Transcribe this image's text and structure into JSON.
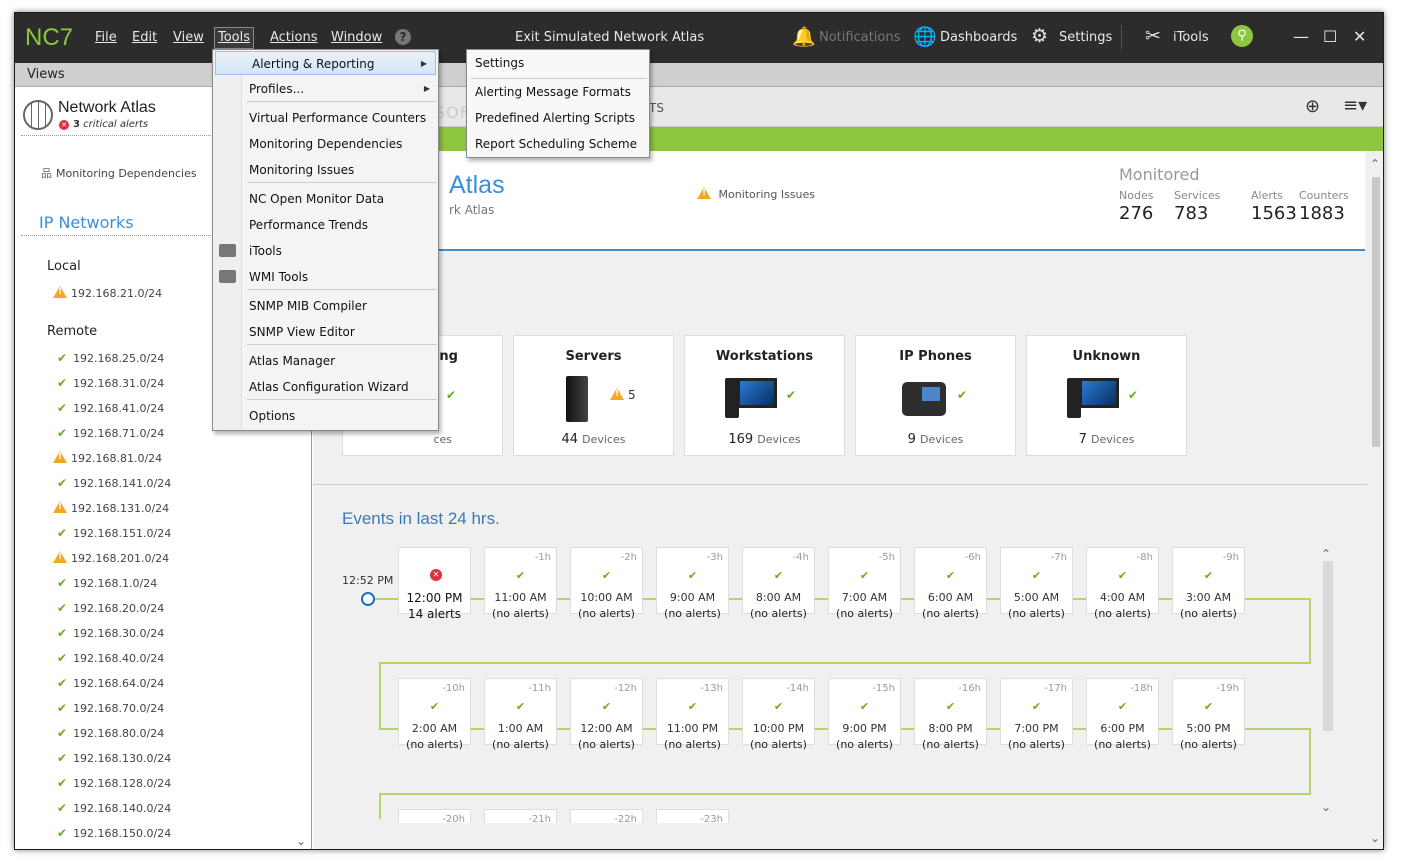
{
  "app": {
    "logo": "NC7",
    "title": "Exit Simulated Network Atlas"
  },
  "menubar": {
    "file": "File",
    "edit": "Edit",
    "view": "View",
    "tools": "Tools",
    "actions": "Actions",
    "window": "Window",
    "help": "?"
  },
  "toolbar": {
    "notifications": "Notifications",
    "dashboards": "Dashboards",
    "settings": "Settings",
    "itools": "iTools"
  },
  "views_label": "Views",
  "sidebar": {
    "atlas_title": "Network Atlas",
    "critical_count": "3",
    "critical_label": "critical alerts",
    "monitoring_dependencies": "Monitoring Dependencies",
    "ip_networks": "IP Networks",
    "local_label": "Local",
    "local_items": [
      {
        "ip": "192.168.21.0/24",
        "status": "warning"
      }
    ],
    "remote_label": "Remote",
    "remote_items": [
      {
        "ip": "192.168.25.0/24",
        "status": "ok"
      },
      {
        "ip": "192.168.31.0/24",
        "status": "ok"
      },
      {
        "ip": "192.168.41.0/24",
        "status": "ok"
      },
      {
        "ip": "192.168.71.0/24",
        "status": "ok"
      },
      {
        "ip": "192.168.81.0/24",
        "status": "warning"
      },
      {
        "ip": "192.168.141.0/24",
        "status": "ok"
      },
      {
        "ip": "192.168.131.0/24",
        "status": "warning"
      },
      {
        "ip": "192.168.151.0/24",
        "status": "ok"
      },
      {
        "ip": "192.168.201.0/24",
        "status": "warning"
      },
      {
        "ip": "192.168.1.0/24",
        "status": "ok"
      },
      {
        "ip": "192.168.20.0/24",
        "status": "ok"
      },
      {
        "ip": "192.168.30.0/24",
        "status": "ok"
      },
      {
        "ip": "192.168.40.0/24",
        "status": "ok"
      },
      {
        "ip": "192.168.64.0/24",
        "status": "ok"
      },
      {
        "ip": "192.168.70.0/24",
        "status": "ok"
      },
      {
        "ip": "192.168.80.0/24",
        "status": "ok"
      },
      {
        "ip": "192.168.130.0/24",
        "status": "ok"
      },
      {
        "ip": "192.168.128.0/24",
        "status": "ok"
      },
      {
        "ip": "192.168.140.0/24",
        "status": "ok"
      },
      {
        "ip": "192.168.150.0/24",
        "status": "ok"
      }
    ]
  },
  "main": {
    "tab_fragment": "TS",
    "atlas_title": "Atlas",
    "atlas_subtitle": "rk Atlas",
    "monitoring_issues": "Monitoring Issues",
    "monitored_label": "Monitored",
    "stats": [
      {
        "label": "Nodes",
        "value": "276"
      },
      {
        "label": "Services",
        "value": "783"
      },
      {
        "label": "Alerts",
        "value": "1563"
      },
      {
        "label": "Counters",
        "value": "1883"
      }
    ],
    "cards": [
      {
        "title": "ing",
        "count": "",
        "unit": "ces",
        "status": "ok"
      },
      {
        "title": "Servers",
        "count": "44",
        "unit": "Devices",
        "status": "warning",
        "warn_count": "5"
      },
      {
        "title": "Workstations",
        "count": "169",
        "unit": "Devices",
        "status": "ok"
      },
      {
        "title": "IP Phones",
        "count": "9",
        "unit": "Devices",
        "status": "ok"
      },
      {
        "title": "Unknown",
        "count": "7",
        "unit": "Devices",
        "status": "ok"
      }
    ],
    "events_title": "Events in last 24 hrs.",
    "timeline_time": "12:52 PM",
    "events_row1": [
      {
        "offset": "",
        "time": "12:00 PM",
        "alerts": "14 alerts",
        "status": "critical"
      },
      {
        "offset": "-1h",
        "time": "11:00 AM",
        "alerts": "(no alerts)",
        "status": "ok"
      },
      {
        "offset": "-2h",
        "time": "10:00 AM",
        "alerts": "(no alerts)",
        "status": "ok"
      },
      {
        "offset": "-3h",
        "time": "9:00 AM",
        "alerts": "(no alerts)",
        "status": "ok"
      },
      {
        "offset": "-4h",
        "time": "8:00 AM",
        "alerts": "(no alerts)",
        "status": "ok"
      },
      {
        "offset": "-5h",
        "time": "7:00 AM",
        "alerts": "(no alerts)",
        "status": "ok"
      },
      {
        "offset": "-6h",
        "time": "6:00 AM",
        "alerts": "(no alerts)",
        "status": "ok"
      },
      {
        "offset": "-7h",
        "time": "5:00 AM",
        "alerts": "(no alerts)",
        "status": "ok"
      },
      {
        "offset": "-8h",
        "time": "4:00 AM",
        "alerts": "(no alerts)",
        "status": "ok"
      },
      {
        "offset": "-9h",
        "time": "3:00 AM",
        "alerts": "(no alerts)",
        "status": "ok"
      }
    ],
    "events_row2": [
      {
        "offset": "-10h",
        "time": "2:00 AM",
        "alerts": "(no alerts)",
        "status": "ok"
      },
      {
        "offset": "-11h",
        "time": "1:00 AM",
        "alerts": "(no alerts)",
        "status": "ok"
      },
      {
        "offset": "-12h",
        "time": "12:00 AM",
        "alerts": "(no alerts)",
        "status": "ok"
      },
      {
        "offset": "-13h",
        "time": "11:00 PM",
        "alerts": "(no alerts)",
        "status": "ok"
      },
      {
        "offset": "-14h",
        "time": "10:00 PM",
        "alerts": "(no alerts)",
        "status": "ok"
      },
      {
        "offset": "-15h",
        "time": "9:00 PM",
        "alerts": "(no alerts)",
        "status": "ok"
      },
      {
        "offset": "-16h",
        "time": "8:00 PM",
        "alerts": "(no alerts)",
        "status": "ok"
      },
      {
        "offset": "-17h",
        "time": "7:00 PM",
        "alerts": "(no alerts)",
        "status": "ok"
      },
      {
        "offset": "-18h",
        "time": "6:00 PM",
        "alerts": "(no alerts)",
        "status": "ok"
      },
      {
        "offset": "-19h",
        "time": "5:00 PM",
        "alerts": "(no alerts)",
        "status": "ok"
      }
    ],
    "events_row3_offsets": [
      "-20h",
      "-21h",
      "-22h",
      "-23h"
    ]
  },
  "tools_menu": [
    {
      "label": "Alerting & Reporting",
      "submenu": true,
      "highlighted": true
    },
    {
      "label": "Profiles...",
      "submenu": true
    },
    {
      "label": "Virtual Performance Counters"
    },
    {
      "label": "Monitoring Dependencies"
    },
    {
      "label": "Monitoring Issues"
    },
    {
      "label": "NC Open Monitor Data"
    },
    {
      "label": "Performance Trends"
    },
    {
      "label": "iTools",
      "icon": "toolbox-icon"
    },
    {
      "label": "WMI Tools",
      "icon": "toolbox-icon"
    },
    {
      "label": "SNMP MIB Compiler"
    },
    {
      "label": "SNMP View Editor"
    },
    {
      "label": "Atlas Manager"
    },
    {
      "label": "Atlas Configuration Wizard"
    },
    {
      "label": "Options"
    }
  ],
  "submenu_alerting": [
    "Settings",
    "Alerting Message Formats",
    "Predefined Alerting Scripts",
    "Report Scheduling Scheme"
  ],
  "watermark": "SOFTPEDIA",
  "colors": {
    "accent_green": "#8dc63f",
    "accent_blue": "#3a8fd8",
    "critical": "#e03040",
    "warning": "#f5a623",
    "titlebar": "#2c2c2c"
  }
}
